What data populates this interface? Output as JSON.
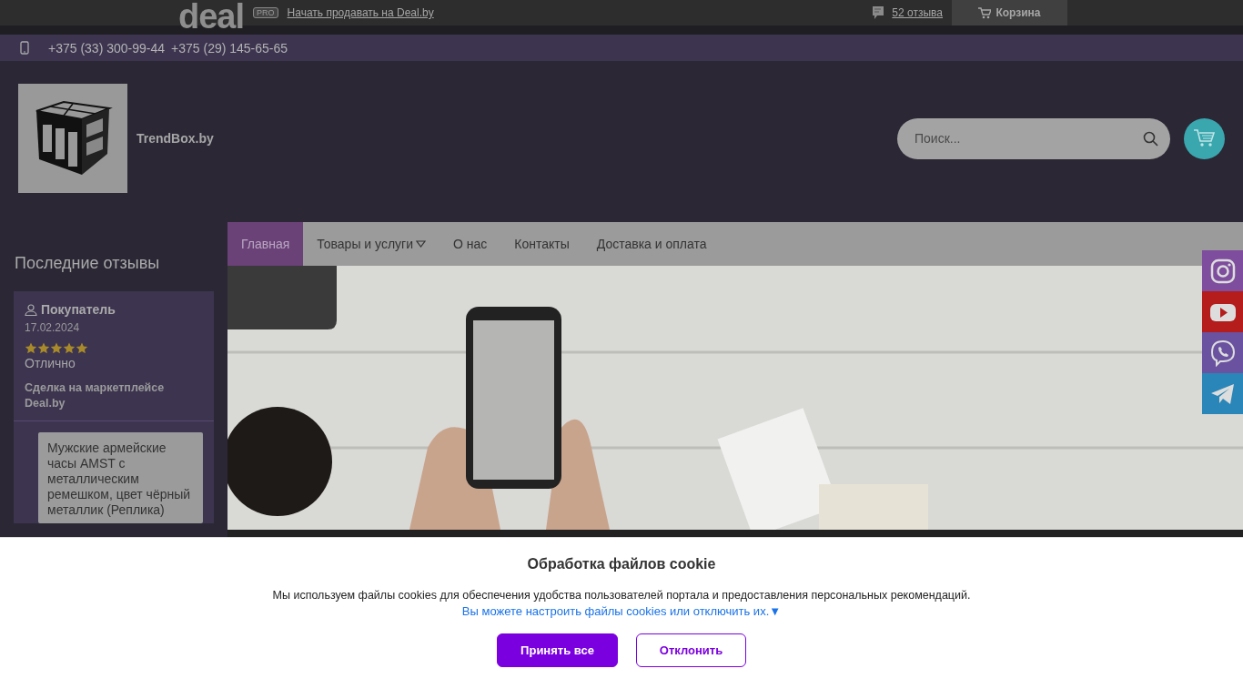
{
  "top_bar": {
    "logo": "deal",
    "badge": "PRO",
    "sell_link": "Начать продавать на Deal.by",
    "reviews_link": "52 отзыва",
    "cart_button": "Корзина"
  },
  "contact_bar": {
    "phones": [
      "+375 (33) 300-99-44",
      "+375 (29) 145-65-65"
    ]
  },
  "header": {
    "shop_name": "TrendBox.by",
    "search": {
      "placeholder": "Поиск..."
    }
  },
  "nav": {
    "items": [
      {
        "label": "Главная",
        "selected": true,
        "has_submenu": false
      },
      {
        "label": "Товары и услуги",
        "selected": false,
        "has_submenu": true
      },
      {
        "label": "О нас",
        "selected": false,
        "has_submenu": false
      },
      {
        "label": "Контакты",
        "selected": false,
        "has_submenu": false
      },
      {
        "label": "Доставка и оплата",
        "selected": false,
        "has_submenu": false
      }
    ]
  },
  "sidebar": {
    "title": "Последние отзывы",
    "reviews": [
      {
        "author": "Покупатель",
        "date": "17.02.2024",
        "stars": 5,
        "text": "Отлично",
        "source": "Сделка на маркетплейсе Deal.by",
        "product": "Мужские армейские часы AMST с металлическим ремешком, цвет чёрный металлик (Реплика)"
      }
    ]
  },
  "social": [
    {
      "kind": "instagram"
    },
    {
      "kind": "youtube"
    },
    {
      "kind": "viber"
    },
    {
      "kind": "telegram"
    }
  ],
  "cookie": {
    "title": "Обработка файлов cookie",
    "text": "Мы используем файлы cookies для обеспечения удобства пользователей портала и предоставления персональных рекомендаций.",
    "settings_link": "Вы можете настроить файлы cookies или отключить их.",
    "settings_arrow": "▼",
    "buttons": [
      {
        "label": "Принять все",
        "kind": "primary"
      },
      {
        "label": "Отклонить",
        "kind": "secondary"
      }
    ]
  }
}
